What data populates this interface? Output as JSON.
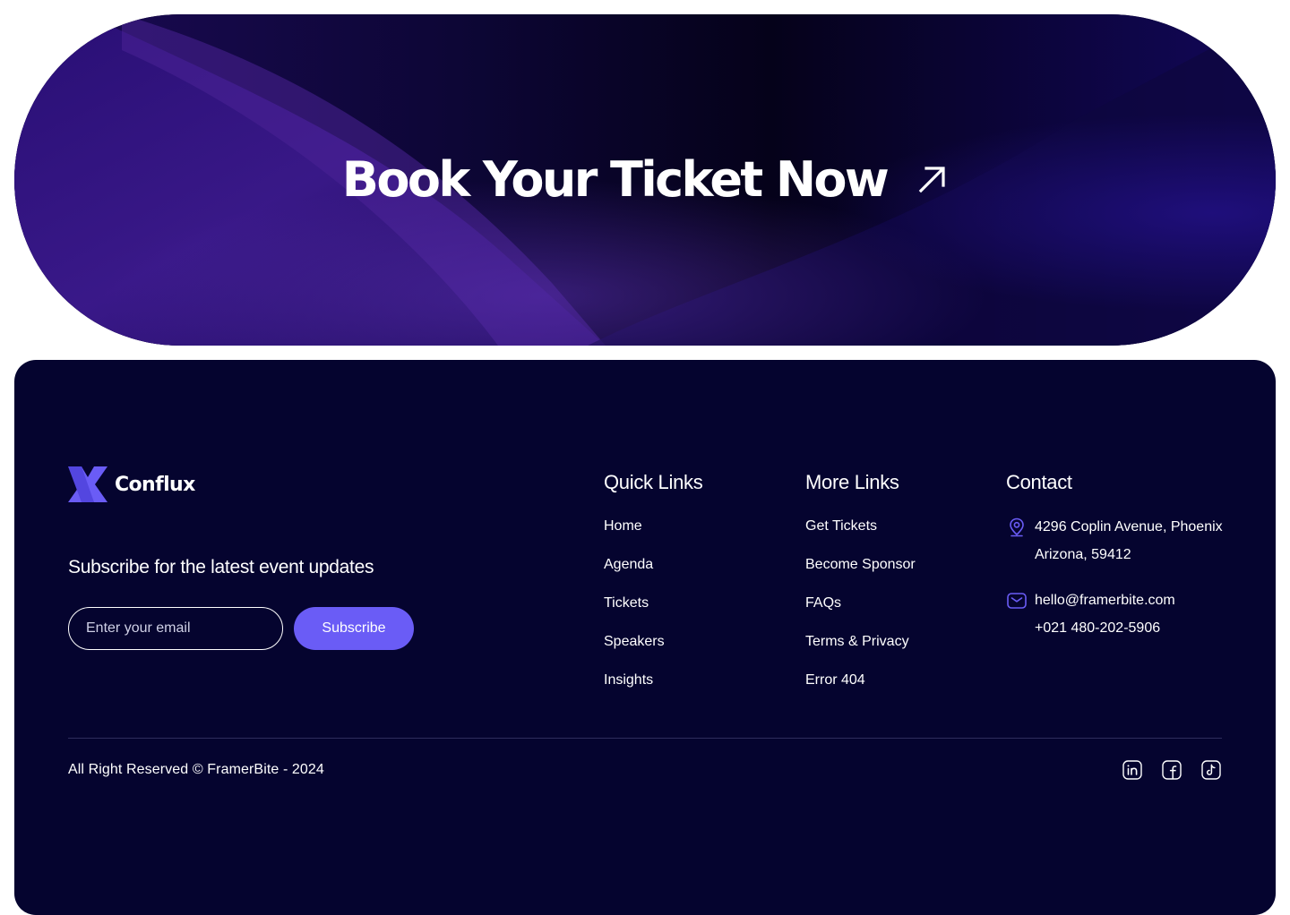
{
  "cta": {
    "title": "Book Your Ticket Now",
    "arrow_icon": "arrow-up-right-icon"
  },
  "footer": {
    "brand": {
      "name": "Conflux",
      "logo_icon": "x-logo-mark",
      "logo_color": "#6a5cf6"
    },
    "subscribe": {
      "heading": "Subscribe for the latest event updates",
      "placeholder": "Enter your email",
      "button_label": "Subscribe"
    },
    "quick_links": {
      "heading": "Quick Links",
      "items": [
        "Home",
        "Agenda",
        "Tickets",
        "Speakers",
        "Insights"
      ]
    },
    "more_links": {
      "heading": "More Links",
      "items": [
        "Get Tickets",
        "Become Sponsor",
        "FAQs",
        "Terms & Privacy",
        "Error 404"
      ]
    },
    "contact": {
      "heading": "Contact",
      "address_line1": "4296 Coplin Avenue, Phoenix",
      "address_line2": "Arizona, 59412",
      "email": "hello@framerbite.com",
      "phone": "+021 480-202-5906",
      "address_icon": "map-pin-icon",
      "email_icon": "mail-icon"
    },
    "copyright": "All Right Reserved © FramerBite - 2024",
    "socials": [
      "linkedin-icon",
      "facebook-icon",
      "tiktok-icon"
    ]
  },
  "colors": {
    "footer_bg": "#05042f",
    "accent": "#6a5cf6",
    "banner_dark": "#07031c",
    "banner_purple": "#3b1a86"
  }
}
